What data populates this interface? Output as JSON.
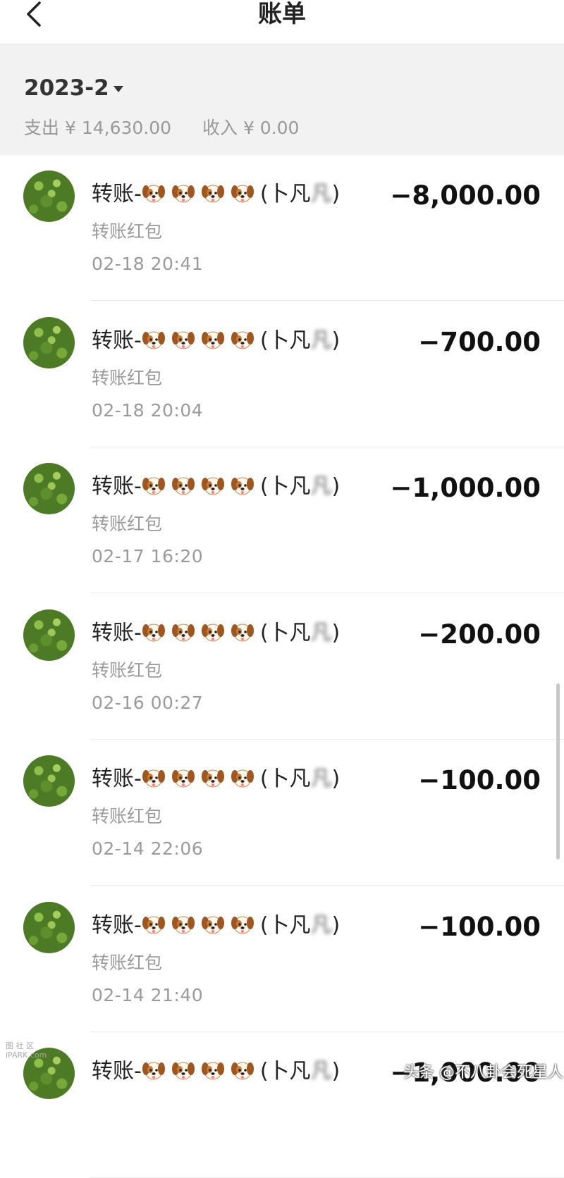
{
  "nav": {
    "title": "账单",
    "back_icon": "chevron-left-icon"
  },
  "summary": {
    "month": "2023-2",
    "expense_label": "支出",
    "expense_value": "¥ 14,630.00",
    "income_label": "收入",
    "income_value": "¥ 0.00"
  },
  "transactions": [
    {
      "prefix": "转账-",
      "name_open": "(卜凡",
      "name_blur": "凡",
      "name_close": ")",
      "type": "转账红包",
      "time": "02-18  20:41",
      "amount": "−8,000.00"
    },
    {
      "prefix": "转账-",
      "name_open": "(卜凡",
      "name_blur": "凡",
      "name_close": ")",
      "type": "转账红包",
      "time": "02-18  20:04",
      "amount": "−700.00"
    },
    {
      "prefix": "转账-",
      "name_open": "(卜凡",
      "name_blur": "凡",
      "name_close": ")",
      "type": "转账红包",
      "time": "02-17  16:20",
      "amount": "−1,000.00"
    },
    {
      "prefix": "转账-",
      "name_open": "(卜凡",
      "name_blur": "凡",
      "name_close": ")",
      "type": "转账红包",
      "time": "02-16  00:27",
      "amount": "−200.00"
    },
    {
      "prefix": "转账-",
      "name_open": "(卜凡",
      "name_blur": "凡",
      "name_close": ")",
      "type": "转账红包",
      "time": "02-14  22:06",
      "amount": "−100.00"
    },
    {
      "prefix": "转账-",
      "name_open": "(卜凡",
      "name_blur": "凡",
      "name_close": ")",
      "type": "转账红包",
      "time": "02-14  21:40",
      "amount": "−100.00"
    },
    {
      "prefix": "转账-",
      "name_open": "(卜凡",
      "name_blur": "凡",
      "name_close": ")",
      "type": "",
      "time": "",
      "amount": "−1,000.00"
    }
  ],
  "watermarks": {
    "left": "图 社 区\niPARK.com",
    "right": "头条 @不八卦会死星人"
  },
  "colors": {
    "summary_bg": "#f2f2f2",
    "secondary_text": "#9a9a9a"
  }
}
